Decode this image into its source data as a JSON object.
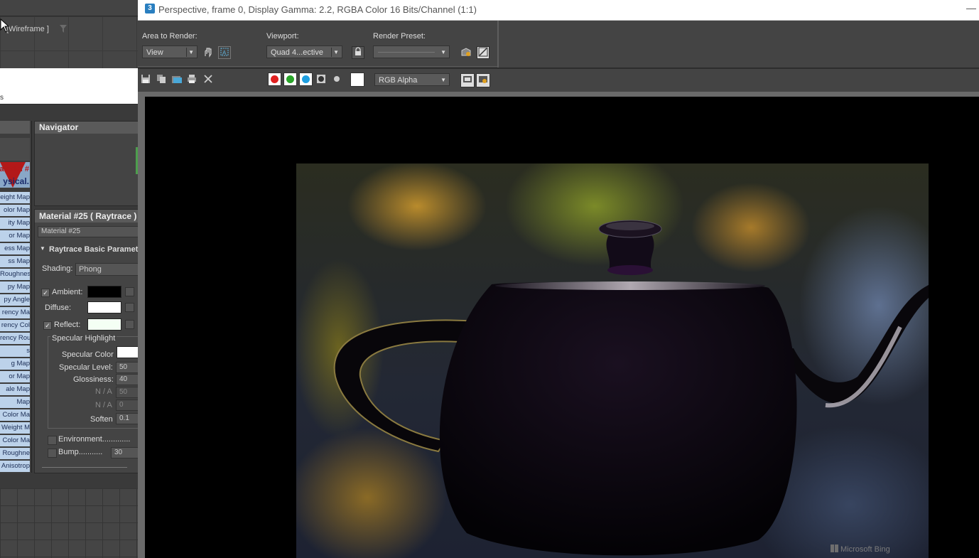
{
  "left_viewport": {
    "label": "[Wireframe ]",
    "partial_text": "s"
  },
  "slots": {
    "material_line1": "aterial #",
    "material_line2": "ysical.",
    "items": [
      "eight Map",
      "olor Map",
      "ity Map",
      "or Map",
      "ess Map",
      "ss Map",
      "Roughnes",
      "py Map",
      "py Angle",
      "rency Ma",
      "rency Col",
      "rency Rou",
      "s",
      "g Map",
      "or Map",
      "ale Map",
      "Map",
      "Color Ma",
      "Weight M",
      "Color Ma",
      "Roughne",
      "Anisotrop"
    ]
  },
  "navigator": {
    "title": "Navigator"
  },
  "material_panel": {
    "title": "Material #25  ( Raytrace )",
    "name_field": "Material #25",
    "rollout_title": "Raytrace Basic Parameters",
    "shading_label": "Shading:",
    "shading_value": "Phong",
    "ambient_label": "Ambient:",
    "diffuse_label": "Diffuse:",
    "reflect_label": "Reflect:",
    "check_mark": "✓",
    "specular_group": "Specular Highlight",
    "specular_color_label": "Specular Color",
    "specular_level_label": "Specular Level:",
    "specular_level": "50",
    "glossiness_label": "Glossiness:",
    "glossiness": "40",
    "na1_label": "N / A",
    "na1_value": "50",
    "na2_label": "N / A",
    "na2_value": "0",
    "soften_label": "Soften",
    "soften_value": "0.1",
    "environment_label": "Environment.............",
    "bump_label": "Bump...........",
    "bump_value": "30",
    "colors": {
      "ambient": "#000000",
      "diffuse": "#ffffff",
      "reflect": "#f4fff4",
      "specular": "#ffffff"
    }
  },
  "render_window": {
    "title": "Perspective, frame 0, Display Gamma: 2.2, RGBA Color 16 Bits/Channel (1:1)",
    "app_icon": "3",
    "minimize": "—",
    "area_to_render_label": "Area to Render:",
    "area_to_render_value": "View",
    "viewport_label": "Viewport:",
    "viewport_value": "Quad 4...ective",
    "render_preset_label": "Render Preset:",
    "render_preset_value": "",
    "channel_value": "RGB Alpha",
    "channel_colors": {
      "red": "#e02020",
      "green": "#2aa52a",
      "blue": "#1e9fe0"
    },
    "watermark": "Microsoft Bing"
  }
}
